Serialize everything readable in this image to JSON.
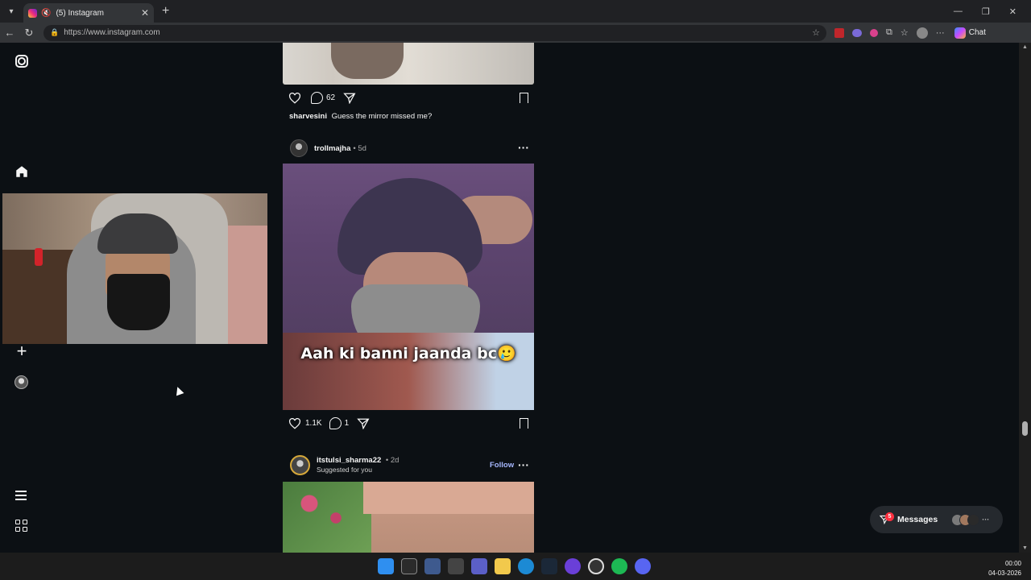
{
  "browser": {
    "tab_title": "(5) Instagram",
    "tab_close": "✕",
    "new_tab": "+",
    "url": "https://www.instagram.com",
    "chat_label": "Chat"
  },
  "feed": {
    "post1": {
      "comment_count": "62",
      "caption_user": "sharvesini",
      "caption_text": "Guess the mirror missed me?"
    },
    "post2": {
      "username": "trollmajha",
      "time": "• 5d",
      "meme_text": "Aah ki banni jaanda bc🥲",
      "like_count": "1.1K",
      "comment_count": "1"
    },
    "post3": {
      "username": "itstulsi_sharma22",
      "time": "• 2d",
      "subtitle": "Suggested for you",
      "follow_label": "Follow"
    }
  },
  "messages": {
    "label": "Messages",
    "unread": "5",
    "more": "···"
  },
  "taskbar": {
    "time": "00:00",
    "date": "04-03-2026"
  },
  "icons": {
    "colors": {
      "accent_follow": "#a7b8ff",
      "badge": "#ff3040",
      "page_bg": "#0c1014"
    }
  }
}
